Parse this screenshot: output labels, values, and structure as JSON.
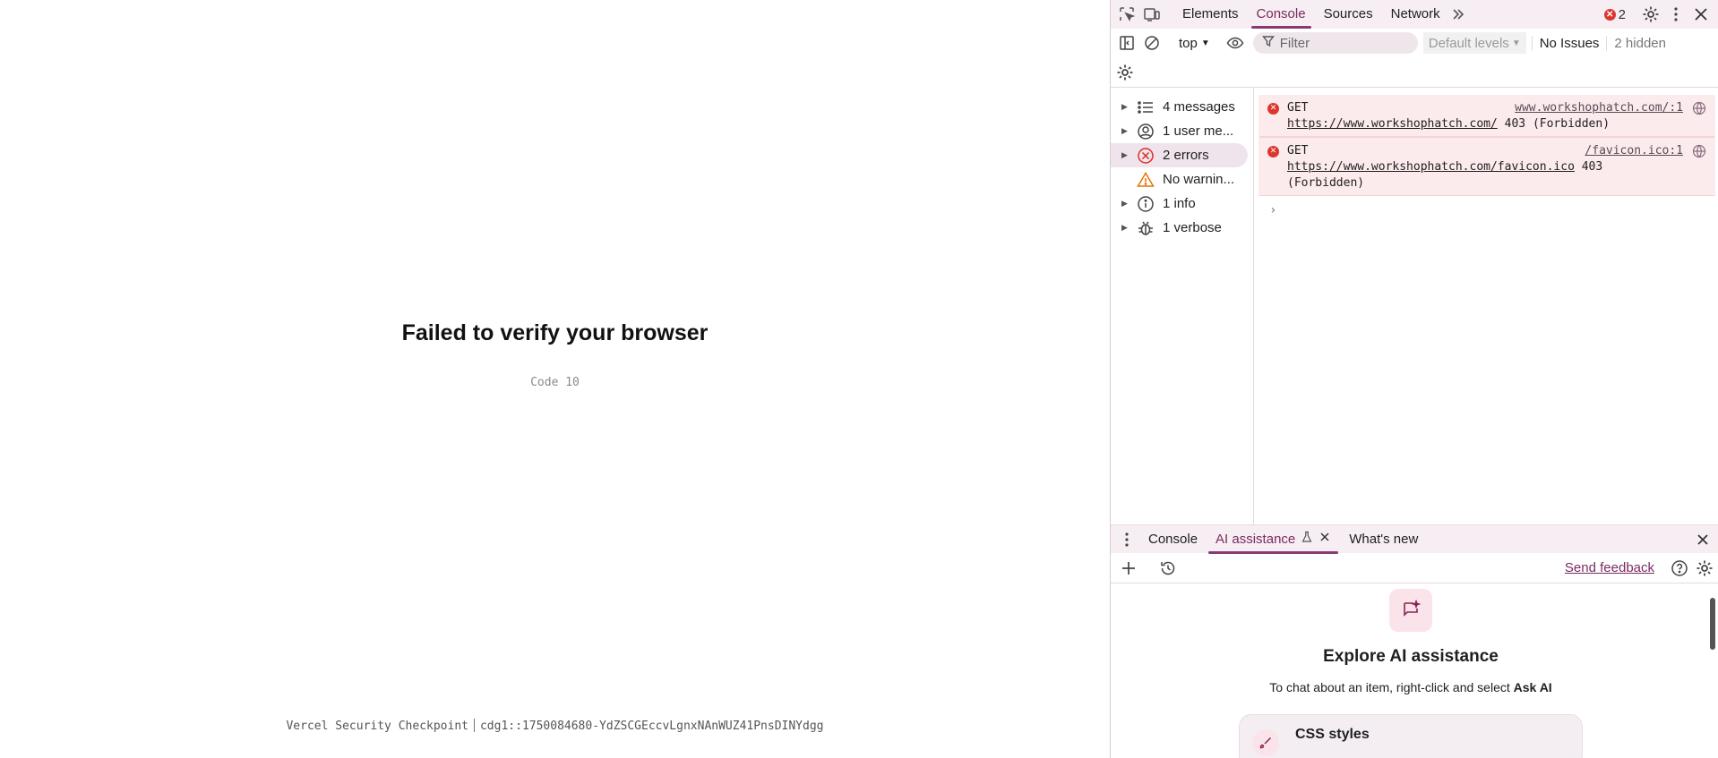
{
  "page": {
    "title": "Failed to verify your browser",
    "code": "Code 10",
    "footer_left": "Vercel Security Checkpoint",
    "footer_right": "cdg1::1750084680-YdZSCGEccvLgnxNAnWUZ41PnsDINYdgg"
  },
  "devtools": {
    "tabs": [
      "Elements",
      "Console",
      "Sources",
      "Network"
    ],
    "active_tab": "Console",
    "error_badge": "2",
    "context": "top",
    "filter_placeholder": "Filter",
    "levels": "Default levels",
    "issues": "No Issues",
    "hidden": "2 hidden",
    "sidebar": [
      {
        "label": "4 messages",
        "icon": "list-icon"
      },
      {
        "label": "1 user me...",
        "icon": "user-icon"
      },
      {
        "label": "2 errors",
        "icon": "error-icon"
      },
      {
        "label": "No warnin...",
        "icon": "warning-icon"
      },
      {
        "label": "1 info",
        "icon": "info-icon"
      },
      {
        "label": "1 verbose",
        "icon": "bug-icon"
      }
    ],
    "messages": [
      {
        "method": "GET",
        "source": "www.workshophatch.com/:1",
        "url": "https://www.workshophatch.com/",
        "status": "403 (Forbidden)"
      },
      {
        "method": "GET",
        "source": "/favicon.ico:1",
        "url": "https://www.workshophatch.com/favicon.ico",
        "status": "403",
        "status2": "(Forbidden)"
      }
    ],
    "drawer": {
      "tabs": [
        "Console",
        "AI assistance",
        "What's new"
      ],
      "active_tab": "AI assistance",
      "send_feedback": "Send feedback",
      "ai_title": "Explore AI assistance",
      "ai_sub_prefix": "To chat about an item, right-click and select ",
      "ai_sub_bold": "Ask AI",
      "card_label": "CSS styles"
    }
  },
  "colors": {
    "accent": "#7a2b61",
    "error": "#dc362e",
    "toolbar_bg": "#f6eef2",
    "error_row_bg": "#fcebec"
  }
}
